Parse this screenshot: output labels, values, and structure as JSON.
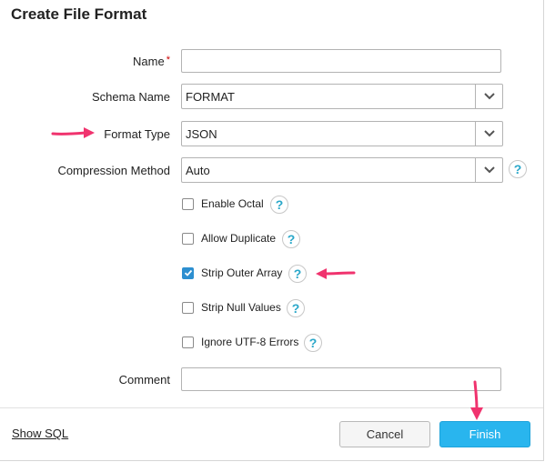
{
  "dialog": {
    "title": "Create File Format"
  },
  "form": {
    "name": {
      "label": "Name",
      "required_mark": "*",
      "value": ""
    },
    "schema_name": {
      "label": "Schema Name",
      "value": "FORMAT"
    },
    "format_type": {
      "label": "Format Type",
      "value": "JSON"
    },
    "compression_method": {
      "label": "Compression Method",
      "value": "Auto"
    },
    "options": [
      {
        "label": "Enable Octal",
        "checked": false
      },
      {
        "label": "Allow Duplicate",
        "checked": false
      },
      {
        "label": "Strip Outer Array",
        "checked": true
      },
      {
        "label": "Strip Null Values",
        "checked": false
      },
      {
        "label": "Ignore UTF-8 Errors",
        "checked": false
      }
    ],
    "comment": {
      "label": "Comment",
      "value": ""
    },
    "help_glyph": "?"
  },
  "footer": {
    "show_sql": "Show SQL",
    "cancel": "Cancel",
    "finish": "Finish"
  },
  "icons": {
    "dropdown": "chevron-down-icon",
    "help": "question-mark-icon",
    "check": "checkmark-icon",
    "annotation": "pink-arrow-icon"
  },
  "colors": {
    "accent": "#29b5ee",
    "help": "#29a7c9",
    "checkbox_checked": "#2d8fd0",
    "annotation_arrow": "#f0336e"
  }
}
